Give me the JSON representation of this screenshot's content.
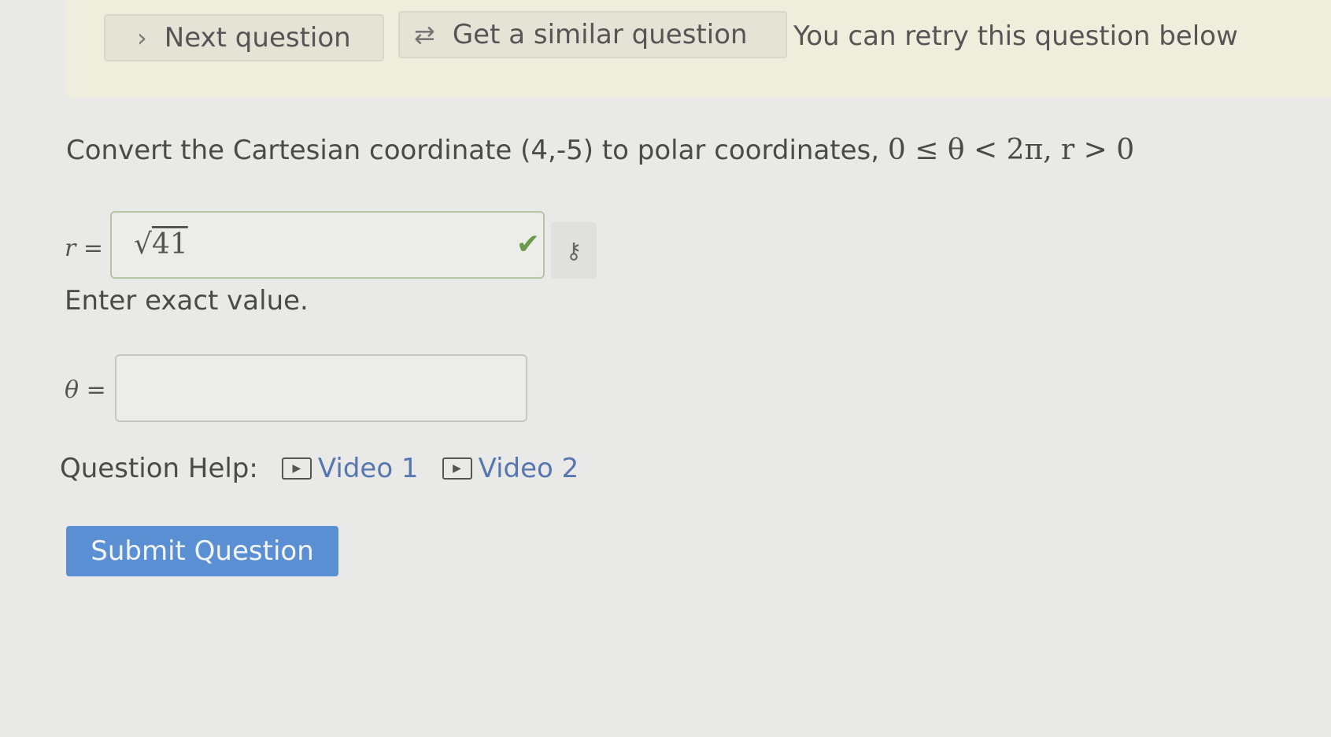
{
  "toolbar": {
    "next_label": "Next question",
    "next_icon": "chevron-right-icon",
    "similar_label": "Get a similar question",
    "similar_icon": "refresh-icon",
    "retry_note": "You can retry this question below"
  },
  "question": {
    "text_prefix": "Convert the Cartesian coordinate (4,-5) to polar coordinates, ",
    "constraint": "0 ≤ θ < 2π, r > 0"
  },
  "answer_r": {
    "label": "r =",
    "value_radical": "√",
    "value_radicand": "41",
    "status": "correct"
  },
  "hint": "Enter exact value.",
  "answer_theta": {
    "label": "θ =",
    "value": ""
  },
  "help": {
    "label": "Question Help:",
    "videos": [
      "Video 1",
      "Video 2"
    ]
  },
  "submit_label": "Submit Question"
}
